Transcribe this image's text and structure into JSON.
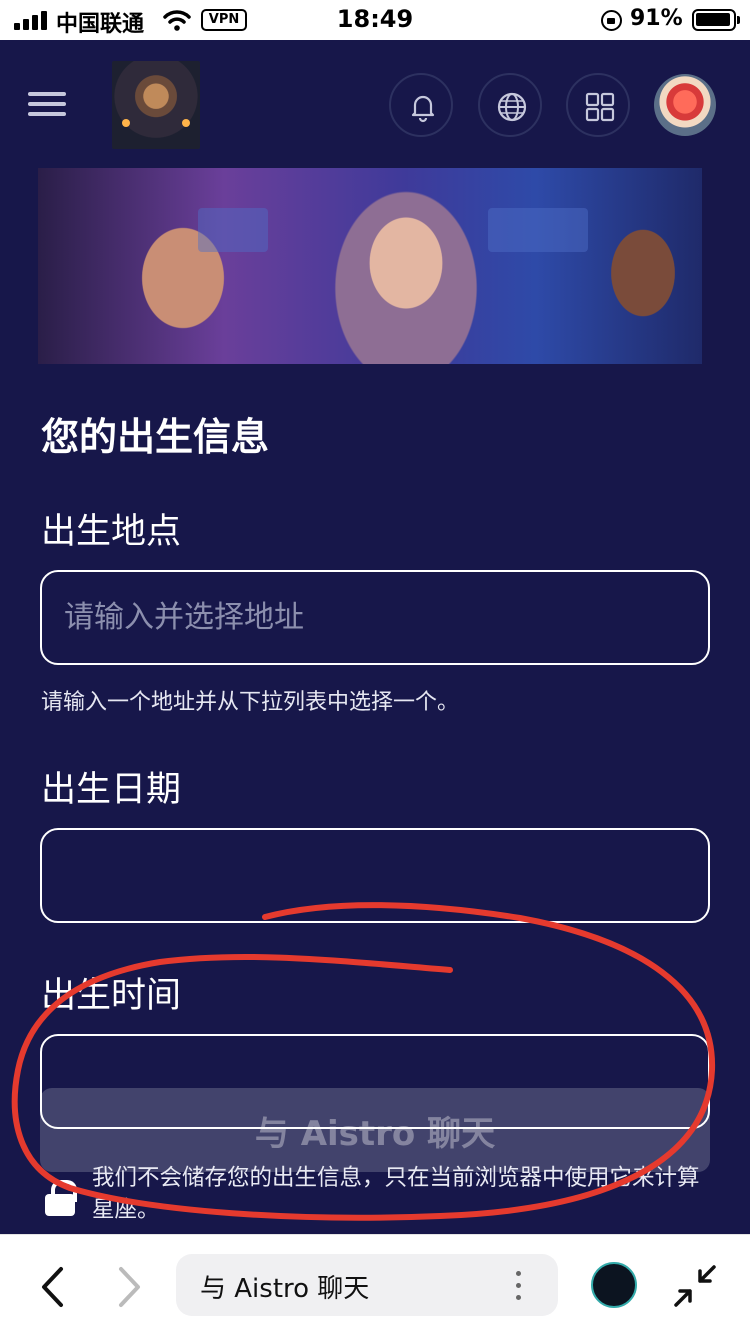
{
  "status_bar": {
    "carrier": "中国联通",
    "vpn": "VPN",
    "time": "18:49",
    "battery": "91%"
  },
  "header": {
    "icons": [
      "menu-icon",
      "logo",
      "bell-icon",
      "globe-icon",
      "grid-icon",
      "avatar"
    ]
  },
  "form": {
    "title": "您的出生信息",
    "place_label": "出生地点",
    "place_placeholder": "请输入并选择地址",
    "place_value": "",
    "place_help": "请输入一个地址并从下拉列表中选择一个。",
    "date_label": "出生日期",
    "date_value": "",
    "time_label": "出生时间",
    "time_value": ""
  },
  "actions": {
    "chat_button": "与 Aistro 聊天",
    "privacy_text": "我们不会储存您的出生信息，只在当前浏览器中使用它来计算星座。"
  },
  "browser_bar": {
    "url_title": "与 Aistro 聊天"
  },
  "colors": {
    "background": "#17174a",
    "annotation": "#e53a2e",
    "input_border": "#ffffff"
  }
}
